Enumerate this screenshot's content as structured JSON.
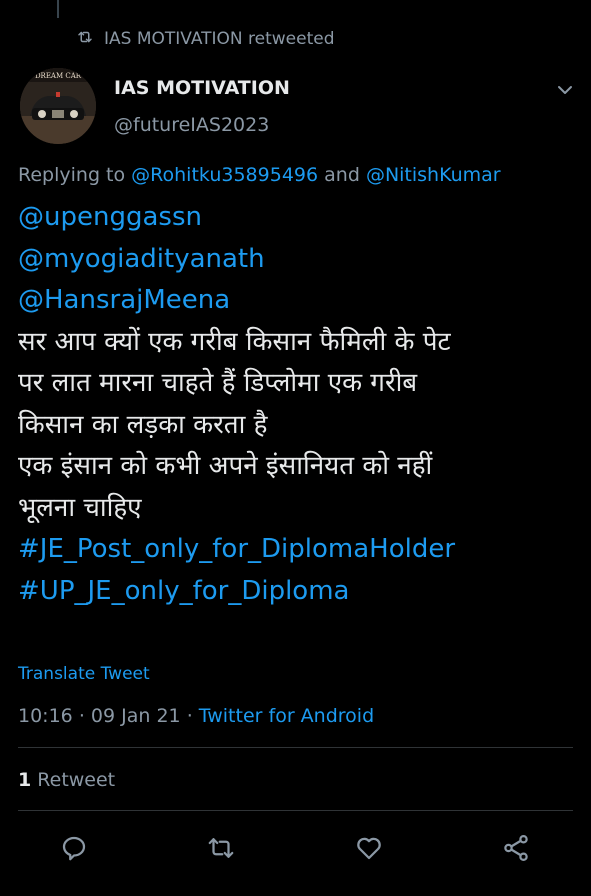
{
  "social_context": {
    "retweeted_by": "IAS MOTIVATION retweeted"
  },
  "author": {
    "name": "IAS MOTIVATION",
    "handle": "@futureIAS2023",
    "avatar_caption": "DREAM CAR"
  },
  "reply": {
    "prefix": "Replying to",
    "to_1": "@Rohitku35895496",
    "joiner": "and",
    "to_2": "@NitishKumar"
  },
  "tweet": {
    "mention_1": "@upenggassn",
    "mention_2": "@myogiadityanath",
    "mention_3": "@HansrajMeena",
    "text_line_1": "सर आप क्यों एक गरीब किसान फैमिली के पेट",
    "text_line_2": "पर लात मारना चाहते हैं डिप्लोमा एक गरीब",
    "text_line_3": "किसान का लड़का करता है",
    "text_line_4": "एक इंसान को कभी अपने इंसानियत को नहीं",
    "text_line_5": "भूलना चाहिए",
    "hashtag_1": "#JE_Post_only_for_DiplomaHolder",
    "hashtag_2": "#UP_JE_only_for_Diploma"
  },
  "translate_label": "Translate Tweet",
  "meta": {
    "time": "10:16",
    "date": "09 Jan 21",
    "separator": "·",
    "source": "Twitter for Android"
  },
  "stats": {
    "retweet_count": "1",
    "retweet_label": "Retweet"
  },
  "actions": [
    "reply-icon",
    "retweet-icon",
    "like-icon",
    "share-icon"
  ],
  "colors": {
    "background": "#000000",
    "link": "#1d9bf0",
    "muted": "#8b98a5",
    "text": "#e7e9ea"
  }
}
